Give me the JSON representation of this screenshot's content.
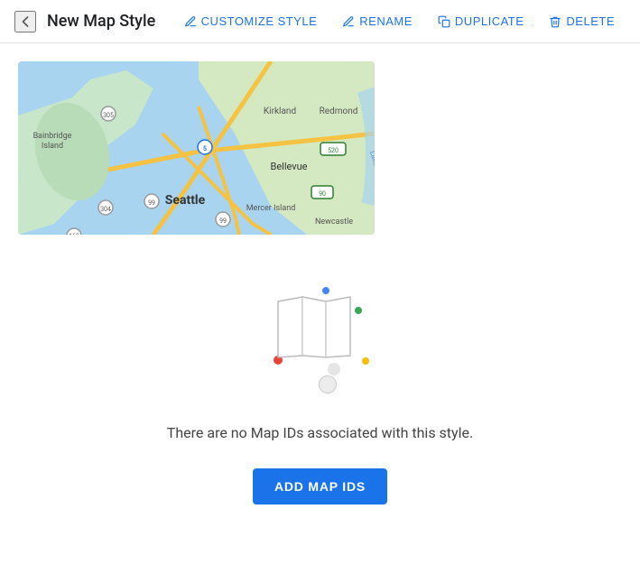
{
  "header": {
    "back_icon": "←",
    "title": "New Map Style",
    "actions": [
      {
        "id": "customize",
        "label": "CUSTOMIZE STYLE",
        "icon": "✏"
      },
      {
        "id": "rename",
        "label": "RENAME",
        "icon": "✏"
      },
      {
        "id": "duplicate",
        "label": "DUPLICATE",
        "icon": "⊞"
      },
      {
        "id": "delete",
        "label": "DELETE",
        "icon": "🗑"
      }
    ]
  },
  "empty_state": {
    "message": "There are no Map IDs associated with this style.",
    "add_button_label": "ADD MAP IDS"
  }
}
